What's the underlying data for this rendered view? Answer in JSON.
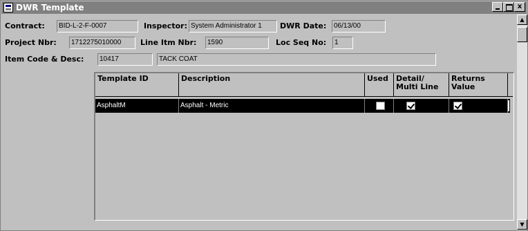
{
  "window": {
    "title": "DWR Template",
    "min_label": "",
    "max_label": "",
    "close_label": "x"
  },
  "header": {
    "contract_label": "Contract:",
    "contract_value": "BID-L-2-F-0007",
    "inspector_label": "Inspector:",
    "inspector_value": "System Administrator 1",
    "dwr_date_label": "DWR Date:",
    "dwr_date_value": "06/13/00",
    "project_label": "Project Nbr:",
    "project_value": "1712275010000",
    "line_itm_label": "Line Itm Nbr:",
    "line_itm_value": "1590",
    "loc_seq_label": "Loc Seq No:",
    "loc_seq_value": "1",
    "item_code_label": "Item Code & Desc:",
    "item_code_value": "10417",
    "item_desc_value": "TACK COAT"
  },
  "grid": {
    "columns": [
      {
        "label": "Template ID"
      },
      {
        "label": "Description"
      },
      {
        "label": "Used"
      },
      {
        "label": "Detail/ Multi Line"
      },
      {
        "label": "Returns Value"
      }
    ],
    "rows": [
      {
        "template_id": "AsphaltM",
        "description": "Asphalt - Metric",
        "used": false,
        "detail_multi_line": true,
        "returns_value": true
      }
    ]
  },
  "scrollbar": {
    "up_arrow": "▲",
    "down_arrow": "▼"
  }
}
